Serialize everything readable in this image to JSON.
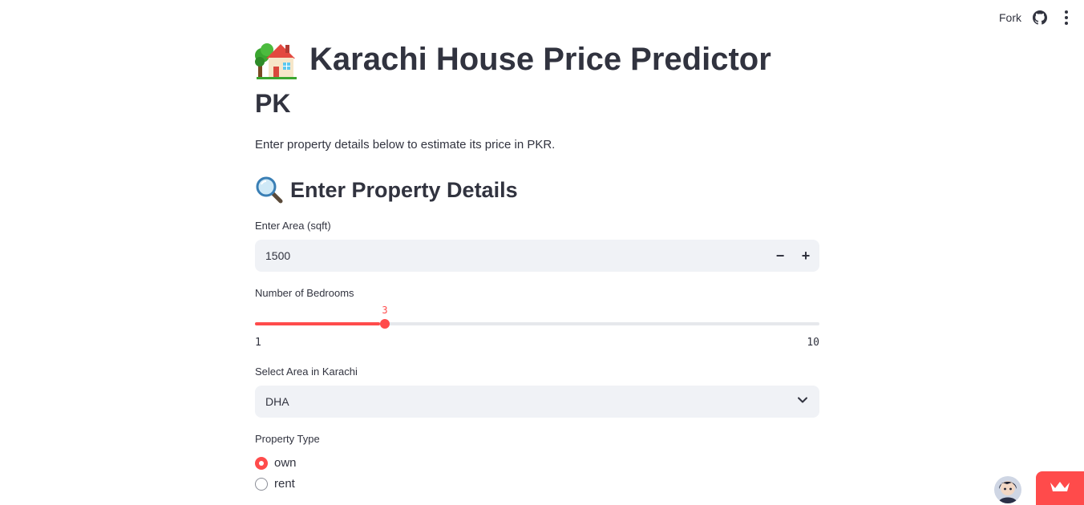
{
  "toolbar": {
    "fork_label": "Fork",
    "github_icon": "github-icon",
    "menu_icon": "kebab-menu-icon"
  },
  "header": {
    "title_emoji": "house-with-garden-emoji",
    "title": "Karachi House Price Predictor",
    "title_line2": "PK",
    "subtitle": "Enter property details below to estimate its price in PKR."
  },
  "section": {
    "emoji": "magnifying-glass-emoji",
    "title": "Enter Property Details"
  },
  "area_input": {
    "label": "Enter Area (sqft)",
    "value": "1500",
    "minus": "−",
    "plus": "+"
  },
  "bedrooms_slider": {
    "label": "Number of Bedrooms",
    "value": 3,
    "value_label": "3",
    "min": 1,
    "max": 10,
    "min_label": "1",
    "max_label": "10"
  },
  "area_select": {
    "label": "Select Area in Karachi",
    "selected": "DHA"
  },
  "property_type": {
    "label": "Property Type",
    "options": [
      {
        "label": "own",
        "selected": true
      },
      {
        "label": "rent",
        "selected": false
      }
    ]
  },
  "colors": {
    "accent": "#ff4b4b",
    "text": "#31333f",
    "input_bg": "#f0f2f6"
  }
}
